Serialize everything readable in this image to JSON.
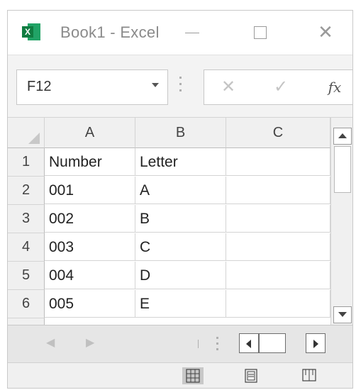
{
  "window": {
    "title": "Book1 - Excel",
    "app_icon_letter": "X",
    "app_icon": "excel-logo-icon",
    "controls": [
      "minimize-icon",
      "maximize-icon",
      "close-icon"
    ]
  },
  "formula_bar": {
    "name_box": "F12",
    "cancel_icon": "✕",
    "enter_icon": "✓",
    "fx_label": "fx",
    "formula_value": ""
  },
  "grid": {
    "columns": [
      "A",
      "B",
      "C"
    ],
    "rows": [
      {
        "num": "1",
        "cells": [
          "Number",
          "Letter",
          ""
        ]
      },
      {
        "num": "2",
        "cells": [
          "001",
          "A",
          ""
        ]
      },
      {
        "num": "3",
        "cells": [
          "002",
          "B",
          ""
        ]
      },
      {
        "num": "4",
        "cells": [
          "003",
          "C",
          ""
        ]
      },
      {
        "num": "5",
        "cells": [
          "004",
          "D",
          ""
        ]
      },
      {
        "num": "6",
        "cells": [
          "005",
          "E",
          ""
        ]
      }
    ]
  },
  "sheet_nav": {
    "prev": "◀",
    "next": "▶"
  },
  "status_bar": {
    "views": [
      "normal-view-icon",
      "page-layout-view-icon",
      "page-break-preview-icon"
    ],
    "active_view": "normal-view-icon"
  },
  "colors": {
    "excel_green": "#107c41",
    "grid_line": "#d4d4d4",
    "header_bg": "#f0f0f0"
  }
}
